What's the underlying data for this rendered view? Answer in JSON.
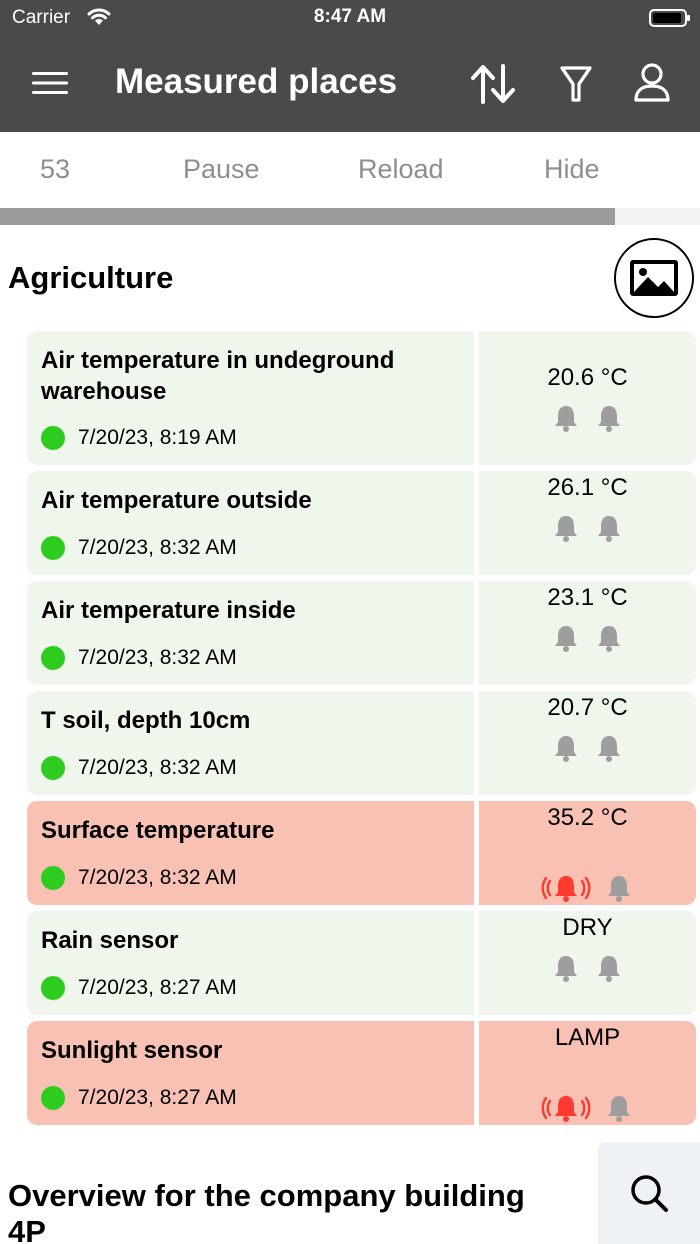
{
  "status_bar": {
    "carrier": "Carrier",
    "time": "8:47 AM"
  },
  "nav": {
    "title": "Measured places",
    "menu_icon": "hamburger-icon",
    "sort_icon": "sort-arrows-icon",
    "filter_icon": "filter-icon",
    "user_icon": "user-icon"
  },
  "toolbar": {
    "count": "53",
    "pause": "Pause",
    "reload": "Reload",
    "hide": "Hide"
  },
  "progress": {
    "fraction": 0.878
  },
  "colors": {
    "header": "#4a4a4a",
    "ok_row": "#eff7ec",
    "alarm_row": "#f8c1b3",
    "status_dot": "#2ecc1f",
    "alarm_bell": "#ff3b30",
    "idle_bell": "#9e9e9e"
  },
  "sections": [
    {
      "title": "Agriculture",
      "icon": "image-icon",
      "rows": [
        {
          "name": "Air temperature in undeground warehouse",
          "timestamp": "7/20/23, 8:19 AM",
          "value": "20.6 °C",
          "state": "ok"
        },
        {
          "name": "Air temperature outside",
          "timestamp": "7/20/23, 8:32 AM",
          "value": "26.1 °C",
          "state": "ok"
        },
        {
          "name": "Air temperature inside",
          "timestamp": "7/20/23, 8:32 AM",
          "value": "23.1 °C",
          "state": "ok"
        },
        {
          "name": "T soil, depth 10cm",
          "timestamp": "7/20/23, 8:32 AM",
          "value": "20.7 °C",
          "state": "ok"
        },
        {
          "name": "Surface temperature",
          "timestamp": "7/20/23, 8:32 AM",
          "value": "35.2 °C",
          "state": "alarm"
        },
        {
          "name": "Rain sensor",
          "timestamp": "7/20/23, 8:27 AM",
          "value": "DRY",
          "state": "ok"
        },
        {
          "name": "Sunlight sensor",
          "timestamp": "7/20/23, 8:27 AM",
          "value": "LAMP",
          "state": "alarm"
        }
      ]
    },
    {
      "title": "Overview for the company building 4P"
    }
  ],
  "search": {
    "icon": "search-icon"
  }
}
